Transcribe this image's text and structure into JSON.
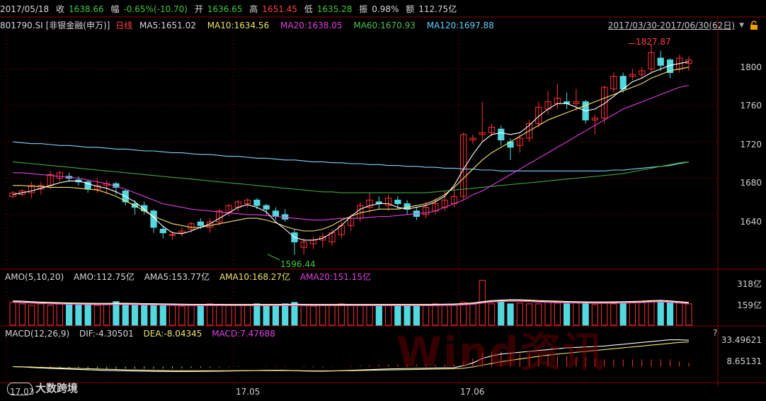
{
  "colors": {
    "up": "#ff3232",
    "down": "#54d8e0",
    "ma5": "#ffffff",
    "ma10": "#f5e36d",
    "ma20": "#e23fe2",
    "ma60": "#3ea83e",
    "ma120": "#7fd3ff",
    "grid": "#5a0000"
  },
  "infobar": {
    "date": "2017/05/18",
    "close_label": "收",
    "close": "1638.66",
    "change_label": "幅",
    "change": "-0.65%(-10.70)",
    "open_label": "开",
    "open": "1636.65",
    "high_label": "高",
    "high": "1651.45",
    "low_label": "低",
    "low": "1635.28",
    "amp_label": "振",
    "amp": "0.98%",
    "amt_label": "额",
    "amt": "112.75亿"
  },
  "title": {
    "code": "801790.SI [非银金融(申万)]",
    "period": "日线",
    "ma5": "MA5:1651.02",
    "ma10": "MA10:1634.56",
    "ma20": "MA20:1638.05",
    "ma60": "MA60:1670.93",
    "ma120": "MA120:1697.88",
    "range": "2017/03/30-2017/06/30(62日)"
  },
  "icons": {
    "dropdown": "chevron-down-icon",
    "lock": "lock-icon"
  },
  "price_axis": [
    "1800",
    "1760",
    "1720",
    "1680",
    "1640"
  ],
  "annotations": {
    "high": "1827.87",
    "low": "1596.44"
  },
  "amo": {
    "label": "AMO(5,10,20)",
    "amo": "AMO:112.75亿",
    "ama5": "AMA5:153.77亿",
    "ama10": "AMA10:168.27亿",
    "ama20": "AMA20:151.15亿",
    "axis": [
      "318亿",
      "159亿"
    ]
  },
  "macd": {
    "label": "MACD(12,26,9)",
    "dif": "DIF:-4.30501",
    "dea": "DEA:-8.04345",
    "macd": "MACD:7.47688",
    "axis": [
      "33.49621",
      "8.65131"
    ],
    "help": "?"
  },
  "dates": [
    "17.03",
    "17.05",
    "17.06"
  ],
  "watermark": "大数跨境",
  "wind_watermark": "Wind资讯",
  "chart_data": {
    "type": "candlestick",
    "ylim": [
      1580,
      1840
    ],
    "candles": [
      [
        1660,
        1664,
        1658,
        1666
      ],
      [
        1662,
        1666,
        1660,
        1668
      ],
      [
        1664,
        1672,
        1658,
        1676
      ],
      [
        1668,
        1672,
        1662,
        1676
      ],
      [
        1672,
        1684,
        1668,
        1688
      ],
      [
        1680,
        1686,
        1676,
        1688
      ],
      [
        1682,
        1680,
        1676,
        1686
      ],
      [
        1678,
        1676,
        1672,
        1682
      ],
      [
        1676,
        1668,
        1664,
        1678
      ],
      [
        1668,
        1672,
        1664,
        1680
      ],
      [
        1672,
        1674,
        1662,
        1678
      ],
      [
        1674,
        1670,
        1662,
        1676
      ],
      [
        1666,
        1654,
        1650,
        1668
      ],
      [
        1652,
        1648,
        1640,
        1656
      ],
      [
        1650,
        1644,
        1640,
        1654
      ],
      [
        1644,
        1626,
        1620,
        1646
      ],
      [
        1624,
        1620,
        1614,
        1628
      ],
      [
        1618,
        1618,
        1612,
        1622
      ],
      [
        1620,
        1622,
        1616,
        1626
      ],
      [
        1624,
        1630,
        1620,
        1632
      ],
      [
        1632,
        1628,
        1624,
        1636
      ],
      [
        1626,
        1632,
        1620,
        1636
      ],
      [
        1632,
        1644,
        1628,
        1646
      ],
      [
        1642,
        1650,
        1638,
        1652
      ],
      [
        1648,
        1654,
        1644,
        1656
      ],
      [
        1652,
        1656,
        1648,
        1658
      ],
      [
        1656,
        1650,
        1646,
        1658
      ],
      [
        1650,
        1646,
        1640,
        1652
      ],
      [
        1644,
        1638,
        1634,
        1648
      ],
      [
        1640,
        1635,
        1632,
        1646
      ],
      [
        1620,
        1610,
        1596,
        1624
      ],
      [
        1604,
        1610,
        1596,
        1614
      ],
      [
        1608,
        1612,
        1602,
        1616
      ],
      [
        1612,
        1616,
        1604,
        1620
      ],
      [
        1610,
        1620,
        1606,
        1624
      ],
      [
        1618,
        1628,
        1614,
        1632
      ],
      [
        1628,
        1636,
        1622,
        1640
      ],
      [
        1636,
        1650,
        1632,
        1654
      ],
      [
        1648,
        1656,
        1642,
        1664
      ],
      [
        1654,
        1652,
        1646,
        1660
      ],
      [
        1650,
        1658,
        1644,
        1662
      ],
      [
        1656,
        1652,
        1646,
        1660
      ],
      [
        1652,
        1646,
        1640,
        1656
      ],
      [
        1644,
        1638,
        1634,
        1648
      ],
      [
        1640,
        1648,
        1636,
        1654
      ],
      [
        1644,
        1652,
        1640,
        1658
      ],
      [
        1648,
        1656,
        1644,
        1666
      ],
      [
        1652,
        1660,
        1648,
        1670
      ],
      [
        1660,
        1728,
        1656,
        1730
      ],
      [
        1722,
        1724,
        1718,
        1728
      ],
      [
        1728,
        1730,
        1720,
        1764
      ],
      [
        1730,
        1736,
        1726,
        1740
      ],
      [
        1734,
        1722,
        1716,
        1738
      ],
      [
        1720,
        1714,
        1700,
        1724
      ],
      [
        1716,
        1724,
        1708,
        1728
      ],
      [
        1724,
        1740,
        1720,
        1744
      ],
      [
        1740,
        1758,
        1736,
        1764
      ],
      [
        1756,
        1764,
        1750,
        1776
      ],
      [
        1762,
        1768,
        1756,
        1784
      ],
      [
        1764,
        1762,
        1756,
        1774
      ],
      [
        1762,
        1764,
        1754,
        1778
      ],
      [
        1764,
        1744,
        1740,
        1766
      ],
      [
        1744,
        1746,
        1728,
        1750
      ],
      [
        1746,
        1780,
        1740,
        1782
      ],
      [
        1778,
        1792,
        1774,
        1796
      ],
      [
        1792,
        1778,
        1774,
        1796
      ],
      [
        1792,
        1794,
        1788,
        1800
      ],
      [
        1794,
        1798,
        1790,
        1802
      ],
      [
        1800,
        1818,
        1796,
        1828
      ],
      [
        1812,
        1804,
        1798,
        1820
      ],
      [
        1810,
        1796,
        1790,
        1812
      ],
      [
        1800,
        1812,
        1796,
        1816
      ],
      [
        1806,
        1810,
        1798,
        1814
      ]
    ],
    "ma5": [
      1662,
      1664,
      1666,
      1669,
      1672,
      1675,
      1677,
      1677,
      1674,
      1671,
      1669,
      1665,
      1660,
      1654,
      1646,
      1637,
      1627,
      1620,
      1619,
      1622,
      1626,
      1630,
      1636,
      1642,
      1648,
      1651,
      1648,
      1643,
      1632,
      1624,
      1615,
      1612,
      1612,
      1614,
      1620,
      1628,
      1638,
      1646,
      1650,
      1652,
      1652,
      1648,
      1646,
      1648,
      1650,
      1654,
      1660,
      1672,
      1690,
      1706,
      1720,
      1728,
      1730,
      1728,
      1730,
      1738,
      1748,
      1756,
      1762,
      1762,
      1758,
      1754,
      1756,
      1762,
      1770,
      1778,
      1786,
      1790,
      1796,
      1800,
      1804,
      1806,
      1808
    ],
    "ma10": [
      1672,
      1672,
      1671,
      1671,
      1670,
      1670,
      1670,
      1669,
      1668,
      1667,
      1664,
      1660,
      1655,
      1650,
      1644,
      1638,
      1634,
      1630,
      1628,
      1626,
      1626,
      1628,
      1630,
      1632,
      1634,
      1636,
      1636,
      1634,
      1631,
      1627,
      1624,
      1622,
      1622,
      1624,
      1628,
      1634,
      1638,
      1642,
      1644,
      1646,
      1646,
      1646,
      1648,
      1650,
      1652,
      1656,
      1662,
      1670,
      1680,
      1690,
      1700,
      1708,
      1714,
      1720,
      1726,
      1732,
      1738,
      1744,
      1748,
      1752,
      1756,
      1760,
      1764,
      1768,
      1772,
      1776,
      1780,
      1784,
      1790,
      1794,
      1798,
      1800,
      1802
    ],
    "ma20": [
      1686,
      1686,
      1685,
      1684,
      1683,
      1682,
      1681,
      1680,
      1678,
      1676,
      1674,
      1671,
      1668,
      1664,
      1660,
      1656,
      1652,
      1650,
      1648,
      1646,
      1645,
      1644,
      1643,
      1642,
      1641,
      1640,
      1640,
      1639,
      1638,
      1637,
      1636,
      1635,
      1634,
      1634,
      1635,
      1636,
      1636,
      1636,
      1637,
      1638,
      1638,
      1639,
      1640,
      1641,
      1642,
      1644,
      1648,
      1652,
      1656,
      1662,
      1666,
      1672,
      1678,
      1684,
      1690,
      1696,
      1702,
      1708,
      1714,
      1720,
      1726,
      1732,
      1738,
      1744,
      1750,
      1756,
      1760,
      1764,
      1768,
      1772,
      1776,
      1780,
      1782
    ],
    "ma60": [
      1698,
      1697,
      1696,
      1695,
      1694,
      1693,
      1692,
      1691,
      1690,
      1689,
      1688,
      1687,
      1686,
      1685,
      1684,
      1683,
      1682,
      1681,
      1680,
      1679,
      1678,
      1677,
      1676,
      1675,
      1674,
      1673,
      1672,
      1671,
      1670,
      1669,
      1668,
      1667,
      1666,
      1665,
      1665,
      1664,
      1664,
      1664,
      1664,
      1664,
      1664,
      1664,
      1664,
      1664,
      1664,
      1665,
      1666,
      1667,
      1668,
      1669,
      1670,
      1671,
      1672,
      1673,
      1674,
      1675,
      1676,
      1677,
      1678,
      1679,
      1680,
      1681,
      1682,
      1683,
      1684,
      1685,
      1687,
      1689,
      1691,
      1693,
      1695,
      1697,
      1698
    ],
    "ma120": [
      1720,
      1719,
      1718,
      1718,
      1717,
      1716,
      1716,
      1715,
      1714,
      1714,
      1713,
      1712,
      1712,
      1711,
      1710,
      1710,
      1709,
      1708,
      1708,
      1707,
      1706,
      1706,
      1705,
      1704,
      1704,
      1703,
      1702,
      1702,
      1701,
      1700,
      1700,
      1699,
      1698,
      1698,
      1697,
      1697,
      1696,
      1696,
      1695,
      1695,
      1694,
      1694,
      1693,
      1693,
      1692,
      1692,
      1691,
      1691,
      1690,
      1690,
      1689,
      1689,
      1688,
      1688,
      1688,
      1688,
      1688,
      1688,
      1688,
      1688,
      1688,
      1688,
      1688,
      1688,
      1689,
      1689,
      1690,
      1691,
      1692,
      1693,
      1694,
      1696,
      1698
    ],
    "amo_ylim": [
      0,
      318
    ],
    "amo": [
      160,
      150,
      140,
      150,
      140,
      155,
      150,
      145,
      150,
      140,
      145,
      165,
      150,
      140,
      145,
      150,
      140,
      140,
      135,
      140,
      145,
      150,
      145,
      140,
      140,
      145,
      150,
      145,
      140,
      150,
      160,
      140,
      135,
      140,
      145,
      150,
      145,
      140,
      140,
      145,
      140,
      145,
      135,
      140,
      145,
      150,
      145,
      140,
      160,
      150,
      310,
      150,
      170,
      150,
      155,
      150,
      150,
      160,
      155,
      150,
      160,
      150,
      145,
      160,
      150,
      155,
      165,
      160,
      170,
      160,
      160,
      155,
      150
    ],
    "amo_ma": [
      170,
      168,
      165,
      162,
      160,
      158,
      156,
      155,
      154,
      153,
      153,
      154,
      154,
      153,
      152,
      151,
      150,
      149,
      148,
      147,
      147,
      147,
      147,
      146,
      146,
      146,
      146,
      146,
      146,
      147,
      148,
      147,
      146,
      146,
      146,
      146,
      146,
      146,
      146,
      146,
      146,
      146,
      146,
      146,
      146,
      147,
      148,
      149,
      152,
      156,
      165,
      172,
      176,
      178,
      178,
      176,
      172,
      170,
      168,
      166,
      165,
      164,
      163,
      163,
      164,
      165,
      166,
      168,
      172,
      174,
      170,
      165,
      160
    ],
    "macd_ylim": [
      -10,
      36
    ],
    "dif": [
      0,
      -0.5,
      -1,
      -1.5,
      -2,
      -2.4,
      -2.8,
      -3.2,
      -3.6,
      -4,
      -4.3,
      -4.6,
      -4.8,
      -5,
      -5.2,
      -5.4,
      -5.5,
      -5.6,
      -5.6,
      -5.5,
      -5.4,
      -5.3,
      -5.2,
      -5,
      -4.8,
      -4.6,
      -4.4,
      -4.2,
      -4.1,
      -4.2,
      -4.6,
      -5,
      -5.2,
      -5.2,
      -5,
      -4.6,
      -4.2,
      -3.8,
      -3.4,
      -3,
      -2.6,
      -2.4,
      -2.2,
      -2,
      -1.8,
      -1.6,
      -1.4,
      -1.2,
      1,
      4,
      9,
      12,
      14,
      15,
      16,
      17,
      18,
      19,
      20,
      21,
      21.5,
      22,
      22.5,
      23,
      24,
      25,
      26,
      27,
      28,
      29,
      30,
      30,
      29.5
    ],
    "dea": [
      0,
      -0.3,
      -0.6,
      -0.9,
      -1.2,
      -1.5,
      -1.8,
      -2.1,
      -2.4,
      -2.7,
      -3,
      -3.3,
      -3.6,
      -3.8,
      -4,
      -4.2,
      -4.4,
      -4.5,
      -4.6,
      -4.7,
      -4.7,
      -4.7,
      -4.7,
      -4.7,
      -4.6,
      -4.6,
      -4.5,
      -4.5,
      -4.5,
      -4.5,
      -4.6,
      -4.7,
      -4.8,
      -4.8,
      -4.8,
      -4.7,
      -4.6,
      -4.4,
      -4.2,
      -4,
      -3.8,
      -3.6,
      -3.4,
      -3.2,
      -3,
      -2.8,
      -2.6,
      -2.4,
      -1.8,
      -0.5,
      1.5,
      3.5,
      5.5,
      7,
      8.5,
      10,
      11.5,
      12.8,
      14,
      15,
      16,
      17,
      18,
      19,
      20,
      21,
      22,
      23,
      24,
      25,
      26,
      27,
      27.5
    ],
    "macd": [
      0,
      -0.4,
      -0.8,
      -1.2,
      -1.6,
      -1.8,
      -2,
      -2.2,
      -2.4,
      -2.6,
      -2.6,
      -2.6,
      -2.4,
      -2.4,
      -2.4,
      -2.4,
      -2.2,
      -2.2,
      -2,
      -1.6,
      -1.4,
      -1.2,
      -1,
      -0.6,
      -0.4,
      0,
      0.2,
      0.6,
      0.8,
      0.6,
      0,
      -0.6,
      -0.8,
      -0.8,
      -0.4,
      0.2,
      0.8,
      1.2,
      1.6,
      2,
      2.4,
      2.4,
      2.4,
      2.4,
      2.4,
      2.4,
      2.4,
      2.4,
      5.6,
      9,
      15,
      17,
      17,
      16,
      15,
      14,
      13,
      12.4,
      12,
      12,
      11,
      10,
      9,
      8,
      8,
      8,
      8,
      8,
      8,
      8,
      8,
      6,
      4
    ]
  }
}
